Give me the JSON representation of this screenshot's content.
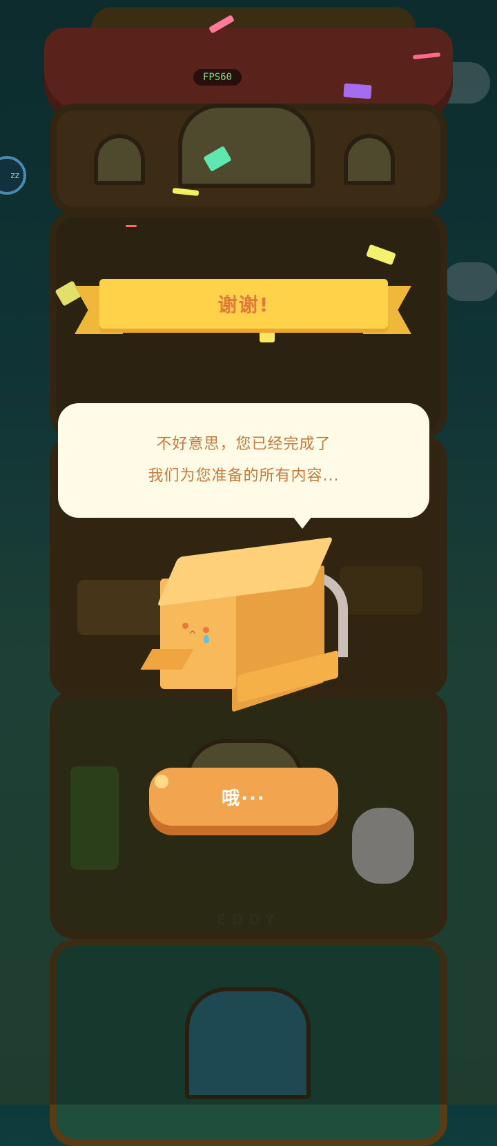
{
  "hud": {
    "fps": "FPS60",
    "side_button": "zz"
  },
  "dialog": {
    "title": "谢谢!",
    "message_line1": "不好意思，您已经完成了",
    "message_line2": "我们为您准备的所有内容...",
    "button_label": "哦···"
  },
  "scene": {
    "floor_label": "EDDY"
  },
  "colors": {
    "ribbon": "#ffd24a",
    "ribbon_text": "#e07a3a",
    "bubble_bg": "#fffbe6",
    "bubble_text": "#c57a3a",
    "button": "#f2a54e",
    "box": "#f7b95a"
  }
}
